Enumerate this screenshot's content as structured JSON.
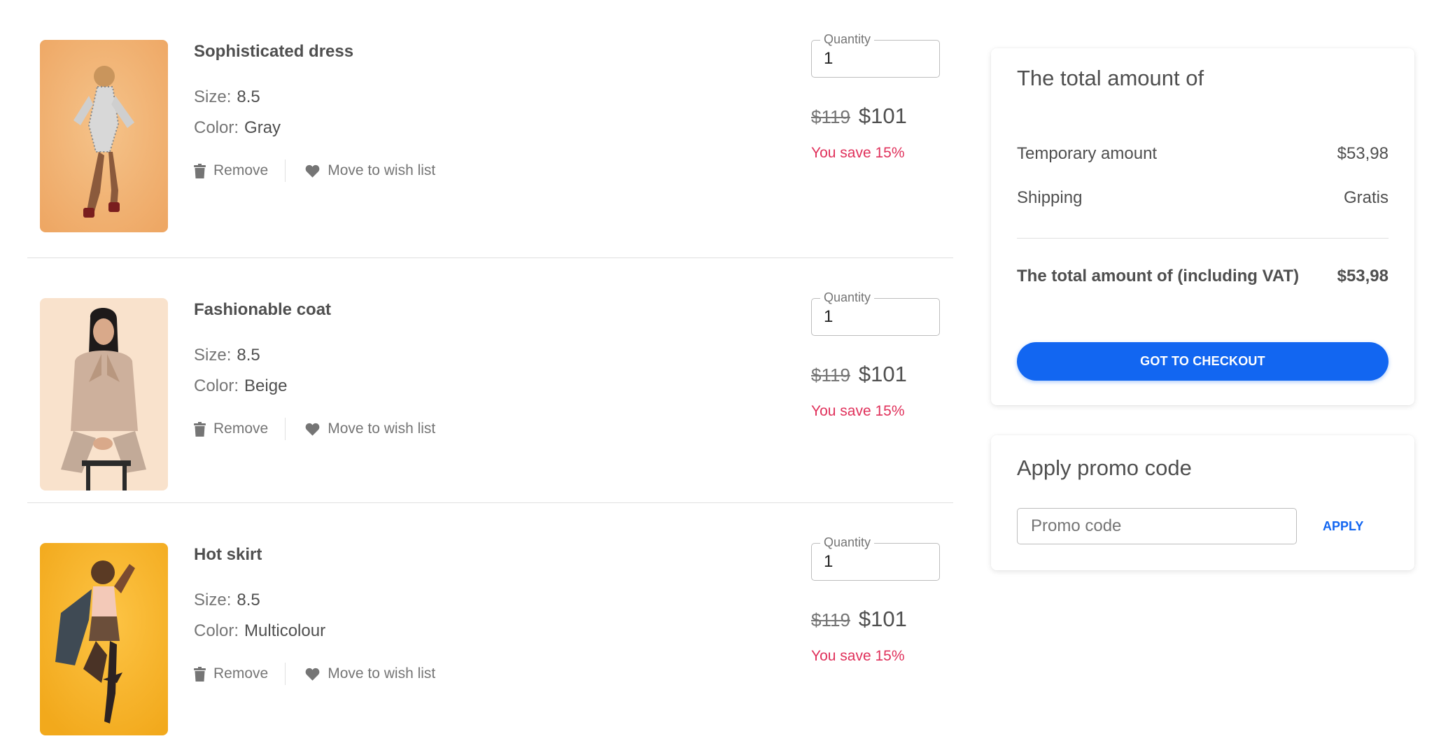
{
  "cart": {
    "items": [
      {
        "name": "Sophisticated dress",
        "size_label": "Size:",
        "size": "8.5",
        "color_label": "Color:",
        "color": "Gray",
        "remove_label": "Remove",
        "wish_label": "Move to wish list",
        "quantity_label": "Quantity",
        "quantity": "1",
        "old_price": "$119",
        "new_price": "$101",
        "saving": "You save 15%",
        "image_icon": "model-in-gray-dress-photo"
      },
      {
        "name": "Fashionable coat",
        "size_label": "Size:",
        "size": "8.5",
        "color_label": "Color:",
        "color": "Beige",
        "remove_label": "Remove",
        "wish_label": "Move to wish list",
        "quantity_label": "Quantity",
        "quantity": "1",
        "old_price": "$119",
        "new_price": "$101",
        "saving": "You save 15%",
        "image_icon": "model-in-beige-coat-photo"
      },
      {
        "name": "Hot skirt",
        "size_label": "Size:",
        "size": "8.5",
        "color_label": "Color:",
        "color": "Multicolour",
        "remove_label": "Remove",
        "wish_label": "Move to wish list",
        "quantity_label": "Quantity",
        "quantity": "1",
        "old_price": "$119",
        "new_price": "$101",
        "saving": "You save 15%",
        "image_icon": "model-in-skirt-photo"
      }
    ]
  },
  "summary": {
    "title": "The total amount of",
    "temporary_label": "Temporary amount",
    "temporary_value": "$53,98",
    "shipping_label": "Shipping",
    "shipping_value": "Gratis",
    "total_label": "The total amount of (including VAT)",
    "total_value": "$53,98",
    "checkout_label": "GOT TO CHECKOUT"
  },
  "promo": {
    "title": "Apply promo code",
    "placeholder": "Promo code",
    "value": "",
    "apply_label": "APPLY"
  },
  "colors": {
    "accent": "#1266f1",
    "saving": "#e0315b",
    "text": "#4f4f4f",
    "muted": "#757575"
  }
}
